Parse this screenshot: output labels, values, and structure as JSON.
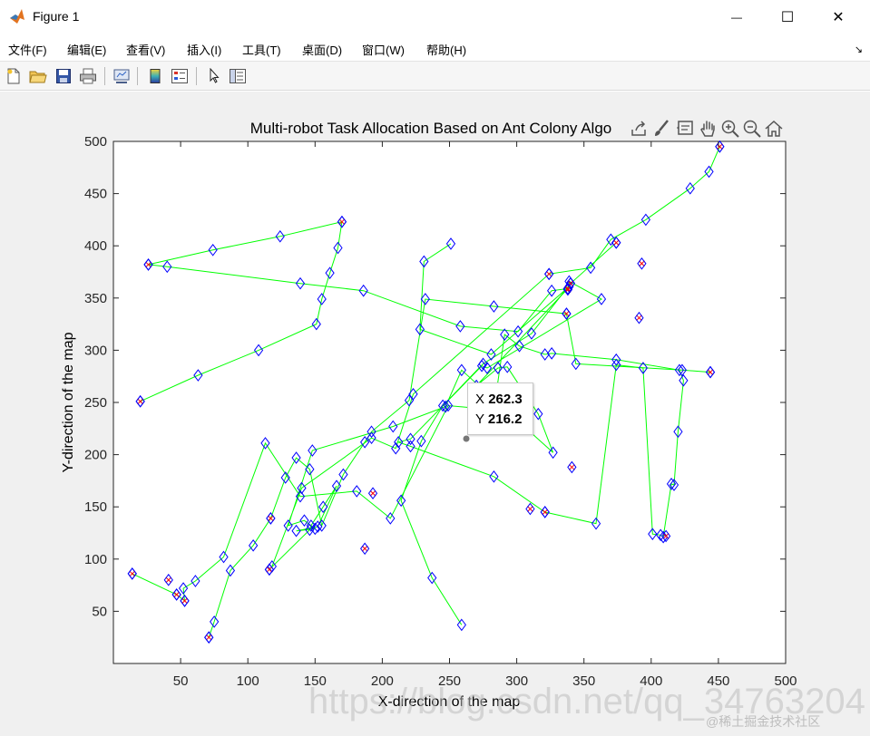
{
  "window": {
    "title": "Figure 1",
    "minimize_glyph": "—",
    "maximize_glyph": "☐",
    "close_glyph": "✕"
  },
  "menu": [
    {
      "label": "文件(F)"
    },
    {
      "label": "编辑(E)"
    },
    {
      "label": "查看(V)"
    },
    {
      "label": "插入(I)"
    },
    {
      "label": "工具(T)"
    },
    {
      "label": "桌面(D)"
    },
    {
      "label": "窗口(W)"
    },
    {
      "label": "帮助(H)"
    }
  ],
  "menu_corner": "↘",
  "toolbar": {
    "buttons": [
      "new-figure-icon",
      "open-icon",
      "save-icon",
      "print-icon",
      "link-plot-icon",
      "colorbar-icon",
      "legend-icon",
      "edit-plot-icon",
      "property-inspector-icon"
    ]
  },
  "axes_toolbar": [
    "export-icon",
    "brush-icon",
    "data-tips-icon",
    "pan-icon",
    "zoom-in-icon",
    "zoom-out-icon",
    "home-icon"
  ],
  "colors": {
    "path": "#00ff00",
    "waypoint": "#0000ff",
    "depot": "#ff0000",
    "figure_bg": "#f0f0f0"
  },
  "chart_data": {
    "type": "line",
    "title": "Multi-robot Task Allocation Based on Ant Colony Algo",
    "xlabel": "X-direction of the map",
    "ylabel": "Y-direction of the map",
    "xlim": [
      0,
      500
    ],
    "ylim": [
      0,
      500
    ],
    "xticks": [
      50,
      100,
      150,
      200,
      250,
      300,
      350,
      400,
      450,
      500
    ],
    "yticks": [
      50,
      100,
      150,
      200,
      250,
      300,
      350,
      400,
      450,
      500
    ],
    "series": [
      {
        "points": [
          [
            259,
            37
          ],
          [
            237,
            82
          ],
          [
            214,
            156
          ],
          [
            229,
            213
          ],
          [
            245,
            247
          ],
          [
            275,
            287
          ],
          [
            311,
            316
          ],
          [
            340,
            364
          ],
          [
            374,
            403
          ]
        ]
      },
      {
        "points": [
          [
            71,
            25
          ],
          [
            75,
            40
          ],
          [
            87,
            89
          ],
          [
            104,
            113
          ],
          [
            117,
            139
          ],
          [
            128,
            178
          ],
          [
            136,
            197
          ],
          [
            146,
            186
          ],
          [
            155,
            132
          ],
          [
            171,
            181
          ],
          [
            187,
            212
          ],
          [
            192,
            222
          ],
          [
            220,
            252
          ],
          [
            232,
            349
          ],
          [
            283,
            342
          ],
          [
            337,
            335
          ],
          [
            344,
            287
          ],
          [
            423,
            281
          ],
          [
            444,
            279
          ]
        ]
      },
      {
        "points": [
          [
            14,
            86
          ],
          [
            47,
            66
          ],
          [
            53,
            60
          ],
          [
            52,
            72
          ],
          [
            61,
            79
          ],
          [
            82,
            102
          ],
          [
            113,
            211
          ],
          [
            139,
            160
          ],
          [
            181,
            165
          ],
          [
            206,
            139
          ],
          [
            249,
            247
          ],
          [
            283,
            243
          ],
          [
            291,
            315
          ],
          [
            302,
            304
          ],
          [
            321,
            296
          ],
          [
            326,
            297
          ],
          [
            374,
            291
          ],
          [
            421,
            281
          ],
          [
            424,
            271
          ],
          [
            420,
            222
          ],
          [
            417,
            171
          ],
          [
            415,
            172
          ],
          [
            409,
            121
          ],
          [
            407,
            123
          ],
          [
            401,
            124
          ],
          [
            394,
            283
          ],
          [
            374,
            286
          ],
          [
            359,
            134
          ],
          [
            321,
            145
          ],
          [
            283,
            179
          ],
          [
            221,
            208
          ],
          [
            212,
            212
          ],
          [
            221,
            215
          ],
          [
            274,
            285
          ],
          [
            278,
            283
          ],
          [
            363,
            349
          ],
          [
            339,
            366
          ],
          [
            339,
            361
          ],
          [
            281,
            296
          ],
          [
            228,
            320
          ],
          [
            231,
            385
          ],
          [
            251,
            402
          ]
        ]
      },
      {
        "points": [
          [
            20,
            251
          ],
          [
            63,
            276
          ],
          [
            108,
            300
          ],
          [
            151,
            325
          ],
          [
            155,
            349
          ],
          [
            161,
            374
          ],
          [
            167,
            398
          ],
          [
            170,
            423
          ],
          [
            124,
            409
          ],
          [
            74,
            396
          ],
          [
            26,
            382
          ],
          [
            40,
            380
          ],
          [
            139,
            364
          ],
          [
            186,
            357
          ],
          [
            258,
            323
          ],
          [
            301,
            318
          ],
          [
            326,
            357
          ],
          [
            338,
            359
          ],
          [
            270,
            266
          ],
          [
            286,
            283
          ],
          [
            293,
            284
          ],
          [
            316,
            239
          ],
          [
            327,
            202
          ],
          [
            259,
            281
          ],
          [
            247,
            246
          ],
          [
            208,
            227
          ],
          [
            148,
            204
          ],
          [
            130,
            132
          ],
          [
            142,
            137
          ],
          [
            150,
            129
          ],
          [
            136,
            127
          ],
          [
            152,
            131
          ],
          [
            166,
            170
          ],
          [
            156,
            150
          ],
          [
            147,
            132
          ],
          [
            146,
            128
          ],
          [
            116,
            90
          ],
          [
            118,
            93
          ],
          [
            140,
            168
          ],
          [
            192,
            216
          ],
          [
            210,
            206
          ],
          [
            223,
            258
          ],
          [
            324,
            373
          ],
          [
            355,
            379
          ],
          [
            370,
            406
          ],
          [
            396,
            425
          ],
          [
            429,
            455
          ],
          [
            443,
            471
          ],
          [
            451,
            495
          ]
        ]
      }
    ],
    "depots": [
      [
        14,
        86
      ],
      [
        20,
        251
      ],
      [
        26,
        382
      ],
      [
        53,
        60
      ],
      [
        47,
        66
      ],
      [
        41,
        80
      ],
      [
        71,
        25
      ],
      [
        116,
        90
      ],
      [
        117,
        139
      ],
      [
        170,
        423
      ],
      [
        187,
        110
      ],
      [
        193,
        163
      ],
      [
        324,
        373
      ],
      [
        337,
        335
      ],
      [
        338,
        358
      ],
      [
        340,
        364
      ],
      [
        374,
        403
      ],
      [
        393,
        383
      ],
      [
        391,
        331
      ],
      [
        411,
        122
      ],
      [
        444,
        279
      ],
      [
        451,
        495
      ],
      [
        321,
        145
      ],
      [
        310,
        148
      ],
      [
        341,
        188
      ],
      [
        338,
        359
      ]
    ],
    "datatip": {
      "x_label": "X",
      "x_value": "262.3",
      "y_label": "Y",
      "y_value": "216.2",
      "x": 262.3,
      "y": 216.2
    }
  },
  "watermark": "https://blog.csdn.net/qq_34763204",
  "badge": "@稀土掘金技术社区"
}
